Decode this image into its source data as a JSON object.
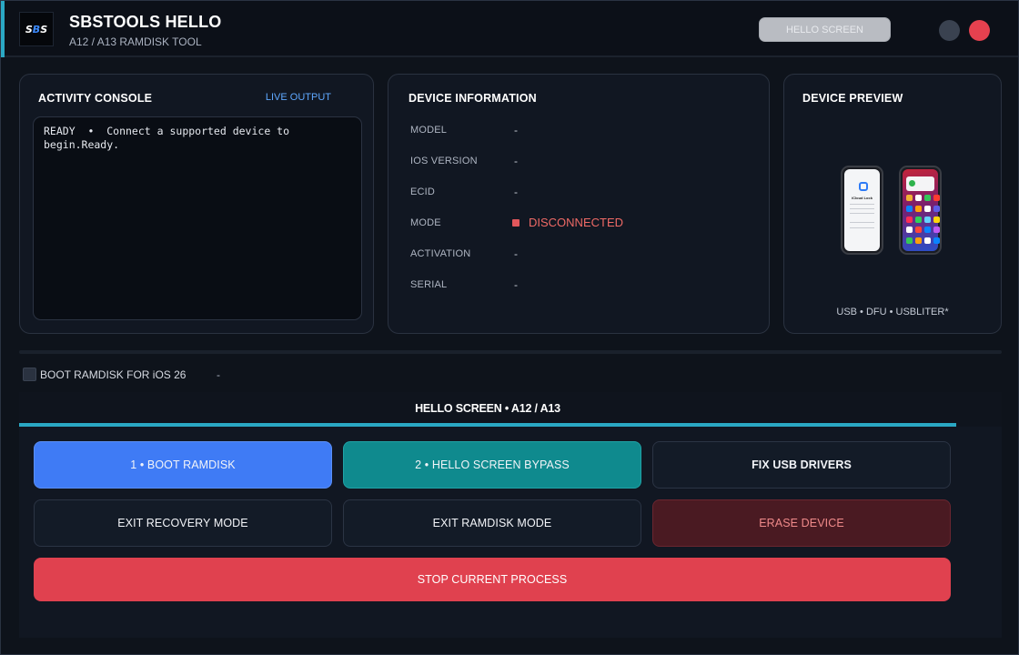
{
  "header": {
    "logo_text_left": "S",
    "logo_text_mid": "B",
    "logo_text_right": "S",
    "title": "SBSTOOLS HELLO",
    "subtitle": "A12 / A13 RAMDISK TOOL",
    "mode_button": "HELLO SCREEN"
  },
  "console": {
    "title": "ACTIVITY CONSOLE",
    "live_label": "LIVE OUTPUT",
    "text": "READY  •  Connect a supported device to\nbegin.Ready."
  },
  "device_info": {
    "title": "DEVICE INFORMATION",
    "rows": [
      {
        "label": "MODEL",
        "value": "-"
      },
      {
        "label": "IOS VERSION",
        "value": "-"
      },
      {
        "label": "ECID",
        "value": "-"
      },
      {
        "label": "MODE",
        "value": "DISCONNECTED"
      },
      {
        "label": "ACTIVATION",
        "value": "-"
      },
      {
        "label": "SERIAL",
        "value": "-"
      }
    ],
    "status_color": "#ef6a66"
  },
  "preview": {
    "title": "DEVICE PREVIEW",
    "phone1_label": "iCloud Lock",
    "caption": "USB  •  DFU  •  USBLITER*"
  },
  "options": {
    "boot_ios26_label": "BOOT RAMDISK FOR iOS 26",
    "boot_ios26_checked": false,
    "boot_ios26_value": "-"
  },
  "actions": {
    "tab_label": "HELLO SCREEN • A12 / A13",
    "buttons": {
      "boot_ramdisk": "1  •  BOOT RAMDISK",
      "bypass": "2  •  HELLO SCREEN BYPASS",
      "fix_usb": "FIX USB DRIVERS",
      "exit_recovery": "EXIT RECOVERY MODE",
      "exit_ramdisk": "EXIT RAMDISK MODE",
      "erase": "ERASE DEVICE",
      "stop": "STOP CURRENT PROCESS"
    }
  },
  "colors": {
    "accent": "#2aa8c4",
    "primary_blue": "#3f7bf5",
    "teal": "#0f8a8e",
    "danger": "#e0414f",
    "close": "#e5414f"
  }
}
